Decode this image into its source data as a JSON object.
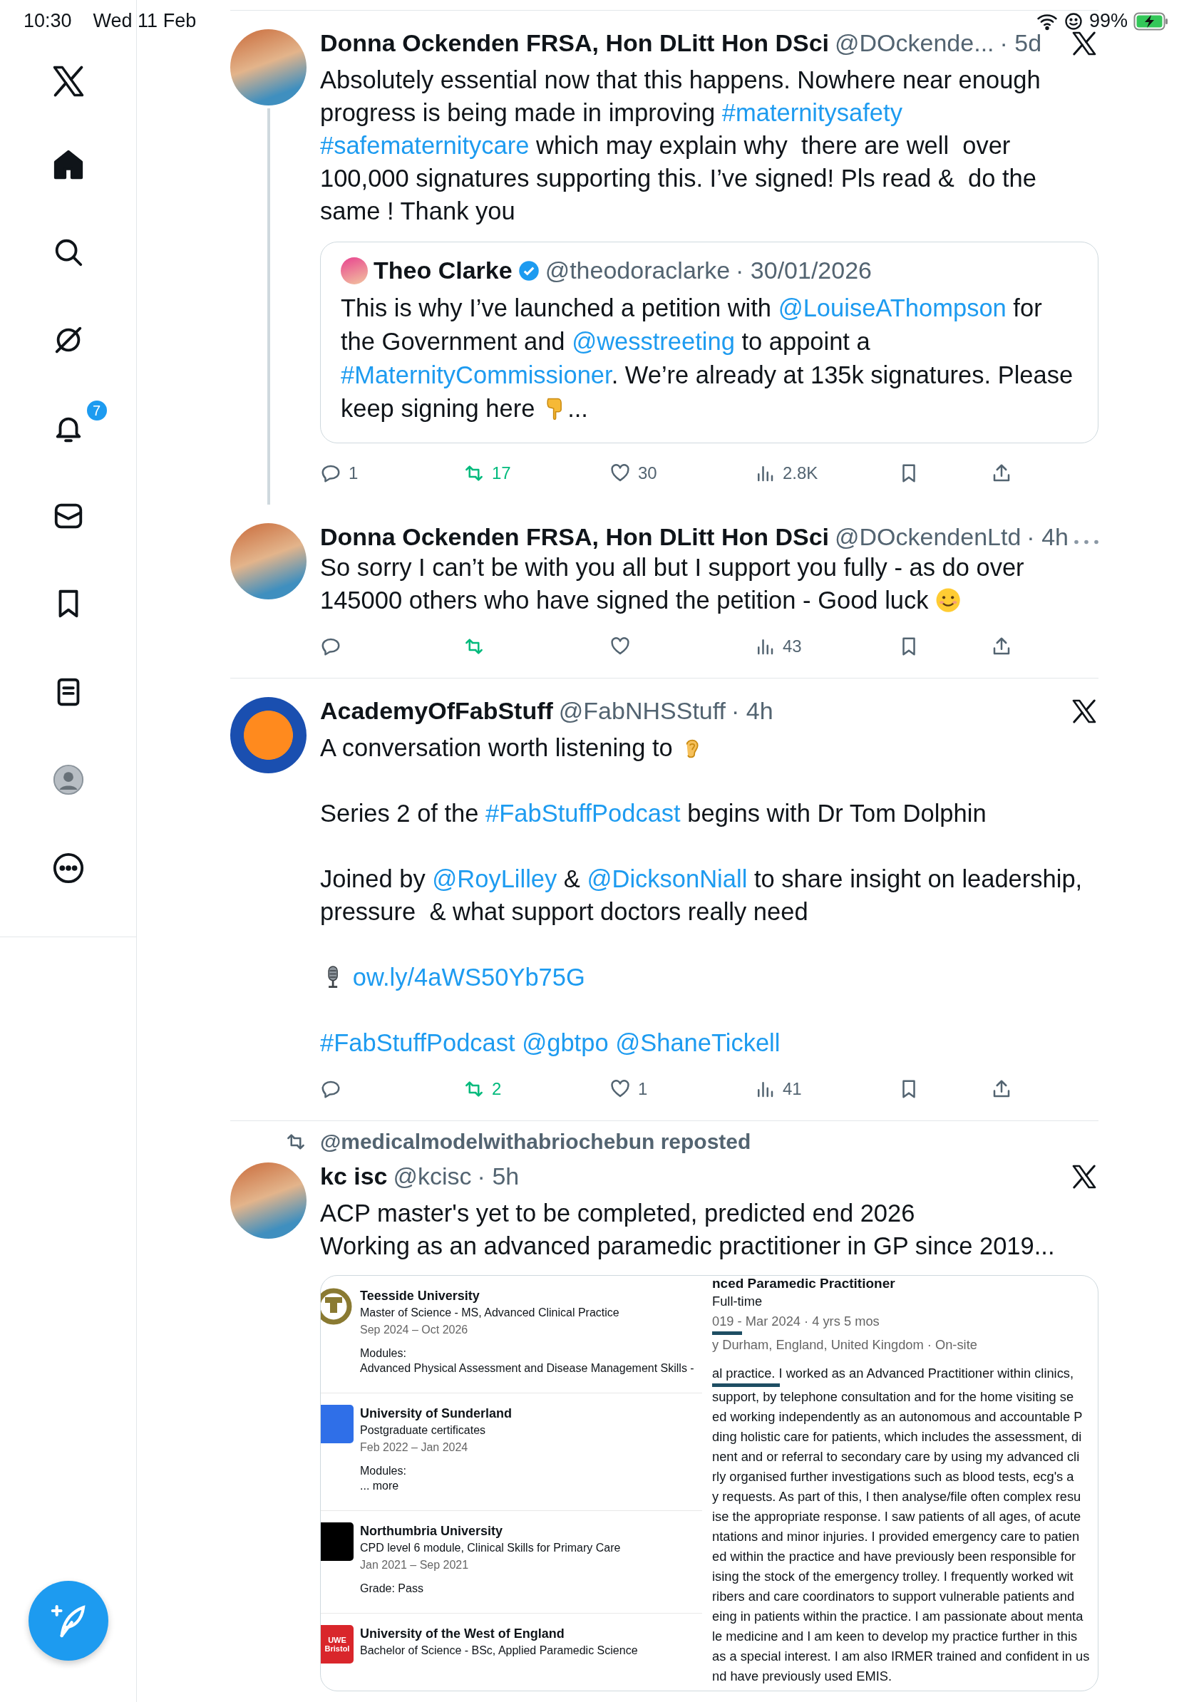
{
  "status_bar": {
    "time": "10:30",
    "date": "Wed 11 Feb",
    "battery": "99%"
  },
  "sidebar": {
    "items": [
      {
        "kind": "home",
        "selected": true
      },
      {
        "kind": "search",
        "selected": false
      },
      {
        "kind": "grok",
        "selected": false
      },
      {
        "kind": "notifications",
        "selected": false,
        "badge": "7"
      },
      {
        "kind": "messages",
        "selected": false
      },
      {
        "kind": "bookmarks",
        "selected": false
      },
      {
        "kind": "lists",
        "selected": false
      },
      {
        "kind": "profile",
        "selected": false
      },
      {
        "kind": "more",
        "selected": false
      }
    ]
  },
  "posts": [
    {
      "avatar": {
        "kind": "photo"
      },
      "name": "Donna Ockenden FRSA, Hon DLitt Hon DSci",
      "handle": "@DOckende...",
      "time": "· 5d",
      "corner": {
        "kind": "x-logo"
      },
      "thread_continues": true,
      "text": {
        "kind": "spaced",
        "paragraphs": [
          [
            {
              "kind": "text",
              "text": "Absolutely essential now that this happens. Nowhere near enough progress is being made in improving "
            },
            {
              "kind": "link",
              "text": "#maternitysafety"
            },
            {
              "kind": "link",
              "text": "#safematernitycare"
            },
            {
              "kind": "text",
              "text": " which may explain why  there are well  over 100,000 signatures supporting this. I’ve signed! Pls read &  do the same ! Thank you"
            }
          ]
        ]
      },
      "quote": {
        "name": "Theo Clarke",
        "verified": true,
        "handle": "@theodoraclarke",
        "time": "· 30/01/2026",
        "text": {
          "paragraphs": [
            [
              {
                "kind": "text",
                "text": "This is why I’ve launched a petition with "
              },
              {
                "kind": "link",
                "text": "@LouiseAThompson"
              },
              {
                "kind": "text",
                "text": " for the Government and "
              },
              {
                "kind": "link",
                "text": "@wesstreeting"
              },
              {
                "kind": "text",
                "text": " to appoint a "
              },
              {
                "kind": "link",
                "text": "#MaternityCommissioner"
              },
              {
                "kind": "text",
                "text": ". We’re already at 135k signatures. Please keep signing here "
              },
              {
                "kind": "pointing-hand"
              },
              {
                "kind": "text",
                "text": "..."
              }
            ]
          ]
        }
      },
      "actions": {
        "reply": "1",
        "repost": "17",
        "reposted": true,
        "like": "30",
        "views": "2.8K"
      }
    },
    {
      "avatar": {
        "kind": "photo"
      },
      "name": "Donna Ockenden FRSA, Hon DLitt Hon DSci",
      "handle": "@DOckendenLtd",
      "time": "· 4h",
      "corner": {
        "kind": "more"
      },
      "thread_continues": false,
      "text": {
        "kind": "spaced",
        "paragraphs": [
          [
            {
              "kind": "text",
              "text": "So sorry I can’t be with you all but I support you fully - as do over 145000 others who have signed the petition - Good luck "
            },
            {
              "kind": "smiley"
            }
          ]
        ]
      },
      "actions": {
        "reposted": true,
        "views": "43"
      }
    },
    {
      "avatar": {
        "kind": "logo"
      },
      "name": "AcademyOfFabStuff",
      "handle": "@FabNHSStuff",
      "time": "· 4h",
      "corner": {
        "kind": "x-logo"
      },
      "thread_continues": false,
      "text": {
        "kind": "spaced",
        "paragraphs": [
          [
            {
              "kind": "text",
              "text": "A conversation worth listening to "
            },
            {
              "kind": "ear"
            }
          ],
          [
            {
              "kind": "text",
              "text": "Series 2 of the "
            },
            {
              "kind": "link",
              "text": "#FabStuffPodcast"
            },
            {
              "kind": "text",
              "text": " begins with Dr Tom Dolphin"
            }
          ],
          [
            {
              "kind": "text",
              "text": "Joined by "
            },
            {
              "kind": "link",
              "text": "@RoyLilley"
            },
            {
              "kind": "text",
              "text": " & "
            },
            {
              "kind": "link",
              "text": "@DicksonNiall"
            },
            {
              "kind": "text",
              "text": " to share insight on leadership, pressure  & what support doctors really need"
            }
          ],
          [
            {
              "kind": "microphone"
            },
            {
              "kind": "link",
              "text": "ow.ly/4aWS50Yb75G"
            }
          ],
          [
            {
              "kind": "link",
              "text": "#FabStuffPodcast"
            },
            {
              "kind": "link",
              "text": "@gbtpo"
            },
            {
              "kind": "link",
              "text": "@ShaneTickell"
            }
          ]
        ]
      },
      "actions": {
        "repost": "2",
        "reposted": true,
        "like": "1",
        "views": "41"
      }
    },
    {
      "repost_label": "@medicalmodelwithabriochebun reposted",
      "avatar": {
        "kind": "photo"
      },
      "name": "kc isc",
      "handle": "@kcisc",
      "time": "· 5h",
      "corner": {
        "kind": "x-logo"
      },
      "thread_continues": false,
      "text": {
        "kind": "tight",
        "paragraphs": [
          [
            {
              "kind": "text",
              "text": "ACP master's yet to be completed, predicted end 2026"
            }
          ],
          [
            {
              "kind": "text",
              "text": "Working as an advanced paramedic practitioner in GP since 2019..."
            }
          ]
        ]
      },
      "attachment": {
        "education": [
          {
            "logo": {
              "kind": "ring"
            },
            "school": "Teesside University",
            "degree": "Master of Science - MS, Advanced Clinical Practice",
            "dates": "Sep 2024 – Oct 2026",
            "details": [
              "Modules:",
              "Advanced Physical Assessment and Disease Management Skills -"
            ]
          },
          {
            "logo": {
              "kind": "tile"
            },
            "color": "#2f6fe8",
            "school": "University of Sunderland",
            "degree": "Postgraduate certificates",
            "dates": "Feb 2022 – Jan 2024",
            "details": [
              "Modules:",
              "... more"
            ]
          },
          {
            "logo": {
              "kind": "tile"
            },
            "color": "#000000",
            "school": "Northumbria University",
            "degree": "CPD level 6 module, Clinical Skills for Primary Care",
            "dates": "Jan 2021 – Sep 2021",
            "details": [
              "Grade: Pass"
            ]
          },
          {
            "logo": {
              "kind": "tile"
            },
            "color": "#d9262b",
            "logo_text": "UWE Bristol",
            "school": "University of the West of England",
            "degree": "Bachelor of Science - BSc, Applied Paramedic Science"
          }
        ],
        "experience": {
          "title": "nced Paramedic Practitioner",
          "type": "Full-time",
          "dates": "019 - Mar 2024 · 4 yrs 5 mos",
          "location": "y Durham, England, United Kingdom · On-site",
          "lines": [
            "al practice. I worked as an Advanced Practitioner within clinics,",
            "support, by telephone consultation and for the home visiting se",
            "ed working independently as an autonomous and accountable P",
            "ding holistic care for patients, which includes the assessment, di",
            "nent and or referral to secondary care by using my advanced cli",
            "rly organised further investigations such as blood tests, ecg's a",
            "y requests. As part of this, I then analyse/file often complex resu",
            "ise the appropriate response. I saw patients of all ages, of acute",
            "ntations and minor injuries. I provided emergency care to patien",
            "ed within the practice and have previously been responsible for",
            "ising the stock of the emergency trolley. I frequently worked wit",
            "ribers and care coordinators to support vulnerable patients and",
            "eing in patients within the practice. I am passionate about menta",
            "le medicine and I am keen to develop my practice further in this",
            "as a special interest. I am also IRMER trained and confident in us",
            "nd have previously used EMIS."
          ]
        }
      }
    }
  ]
}
